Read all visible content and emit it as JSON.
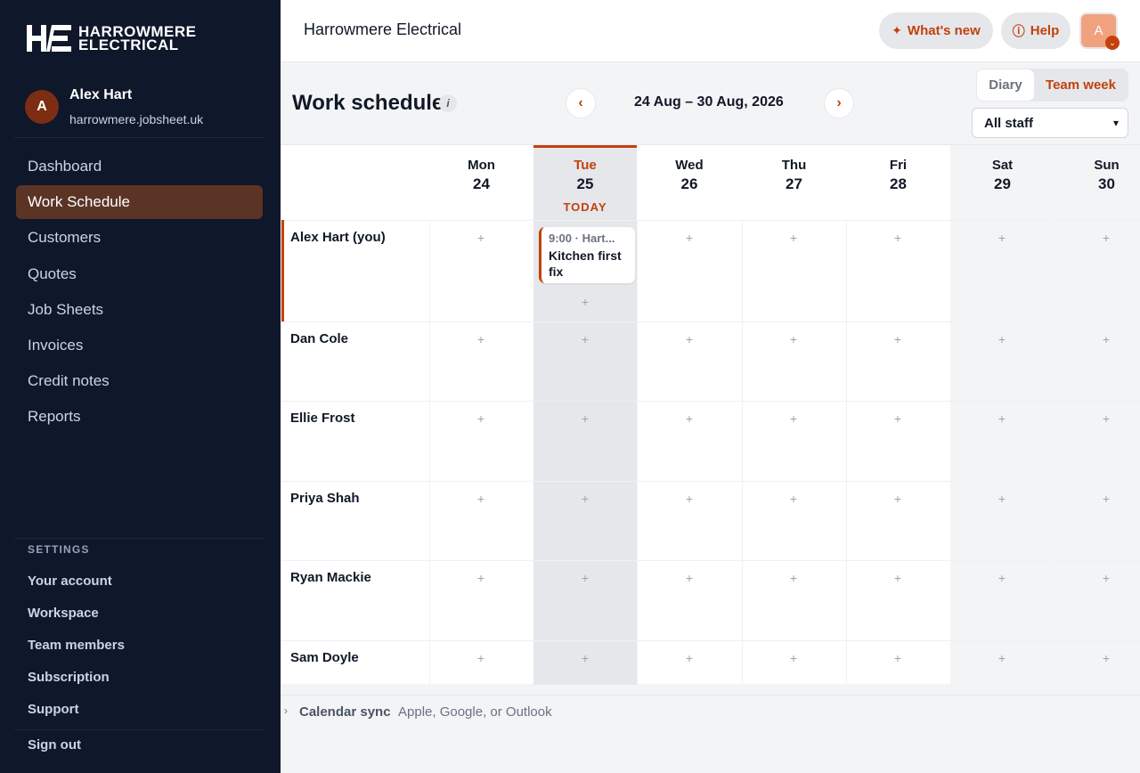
{
  "brand": {
    "line1": "HARROWMERE",
    "line2": "ELECTRICAL"
  },
  "user": {
    "initial": "A",
    "name": "Alex Hart",
    "domain": "harrowmere.jobsheet.uk"
  },
  "nav": {
    "items": [
      {
        "label": "Dashboard",
        "active": false
      },
      {
        "label": "Work Schedule",
        "active": true
      },
      {
        "label": "Customers",
        "active": false
      },
      {
        "label": "Quotes",
        "active": false
      },
      {
        "label": "Job Sheets",
        "active": false
      },
      {
        "label": "Invoices",
        "active": false
      },
      {
        "label": "Credit notes",
        "active": false
      },
      {
        "label": "Reports",
        "active": false
      }
    ]
  },
  "settings": {
    "title": "SETTINGS",
    "items": [
      "Your account",
      "Workspace",
      "Team members",
      "Subscription",
      "Support"
    ],
    "signout": "Sign out"
  },
  "topbar": {
    "company": "Harrowmere Electrical",
    "whats_new": "What's new",
    "help": "Help",
    "avatar_initial": "A"
  },
  "schedule": {
    "title": "Work schedule",
    "info": "i",
    "range": "24 Aug – 30 Aug, 2026",
    "prev": "‹",
    "next": "›",
    "view_diary": "Diary",
    "view_team": "Team week",
    "staff_filter": "All staff",
    "today_label": "TODAY",
    "days": [
      {
        "name": "Mon",
        "num": "24"
      },
      {
        "name": "Tue",
        "num": "25"
      },
      {
        "name": "Wed",
        "num": "26"
      },
      {
        "name": "Thu",
        "num": "27"
      },
      {
        "name": "Fri",
        "num": "28"
      },
      {
        "name": "Sat",
        "num": "29"
      },
      {
        "name": "Sun",
        "num": "30"
      }
    ],
    "staff": [
      "Alex Hart (you)",
      "Dan Cole",
      "Ellie Frost",
      "Priya Shah",
      "Ryan Mackie",
      "Sam Doyle"
    ],
    "event": {
      "time": "9:00 · Hart...",
      "title": "Kitchen first fix"
    },
    "plus": "+"
  },
  "calendar_sync": {
    "title": "Calendar sync",
    "subtitle": "Apple, Google, or Outlook"
  },
  "colors": {
    "accent": "#c2410c",
    "sidebar": "#0f172a",
    "active_nav": "#5b3426"
  }
}
